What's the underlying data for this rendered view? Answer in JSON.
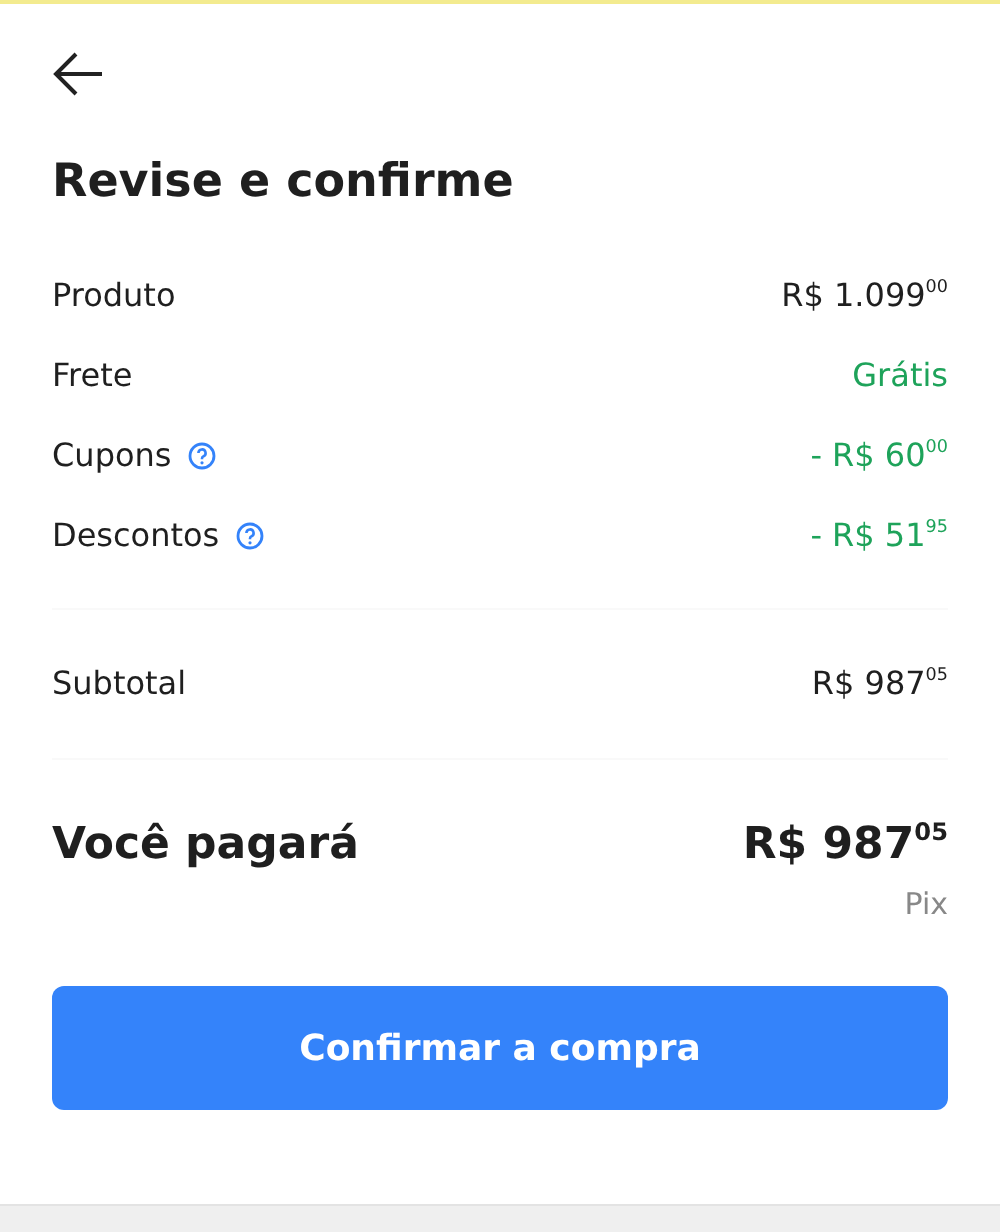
{
  "title": "Revise e confirme",
  "lines": [
    {
      "label": "Produto",
      "value": "R$ 1.099$^{00}$",
      "kind": "price",
      "help": false
    },
    {
      "label": "Frete",
      "value": "Grátis",
      "kind": "benefit",
      "help": false
    },
    {
      "label": "Cupons",
      "value": "- R$ 60$^{00}$",
      "kind": "benefit",
      "help": true
    },
    {
      "label": "Descontos",
      "value": "- R$ 51$^{95}$",
      "kind": "benefit",
      "help": true
    }
  ],
  "subtotal": {
    "label": "Subtotal",
    "value": "R$ 987$^{05}$"
  },
  "total": {
    "label": "Você pagará",
    "value": "R$ 987$^{05}$",
    "method": "Pix"
  },
  "button": "Confirmar a compra"
}
